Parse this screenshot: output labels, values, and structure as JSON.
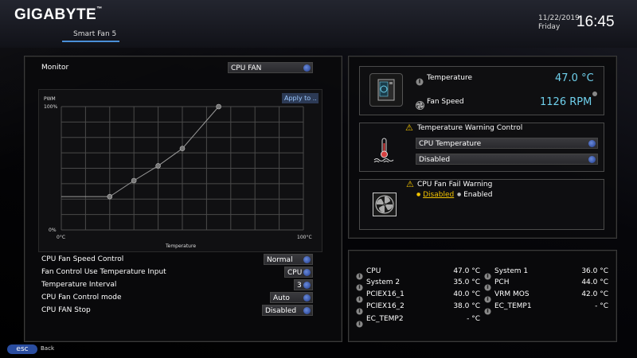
{
  "header": {
    "logo": "GIGABYTE",
    "logo_mark": "™",
    "section": "Smart Fan 5",
    "date": "11/22/2019",
    "day": "Friday",
    "time": "16:45"
  },
  "monitor": {
    "label": "Monitor",
    "selected": "CPU FAN"
  },
  "chart": {
    "apply_label": "Apply to ..",
    "ylabel": "PWM",
    "xlabel": "Temperature",
    "y_max_label": "100%",
    "y_min_label": "0%",
    "x_min_label": "0°C",
    "x_max_label": "100°C"
  },
  "chart_data": {
    "type": "line",
    "xlabel": "Temperature",
    "ylabel": "PWM",
    "x_tick_labels": [
      "0°C",
      "100°C"
    ],
    "y_tick_labels": [
      "0%",
      "100%"
    ],
    "xlim": [
      0,
      100
    ],
    "ylim": [
      0,
      100
    ],
    "grid": true,
    "series": [
      {
        "x": [
          0,
          20,
          30,
          40,
          50,
          65
        ],
        "y": [
          27,
          27,
          40,
          52,
          66,
          100
        ]
      }
    ]
  },
  "settings": [
    {
      "label": "CPU Fan Speed Control",
      "value": "Normal"
    },
    {
      "label": "Fan Control Use Temperature Input",
      "value": "CPU"
    },
    {
      "label": "Temperature Interval",
      "value": "3"
    },
    {
      "label": "CPU Fan Control mode",
      "value": "Auto"
    },
    {
      "label": "CPU FAN Stop",
      "value": "Disabled"
    }
  ],
  "status": {
    "temp_label": "Temperature",
    "temp_value": "47.0 °C",
    "fan_label": "Fan Speed",
    "fan_value": "1126 RPM"
  },
  "warning": {
    "title": "Temperature Warning Control",
    "source": "CPU Temperature",
    "state": "Disabled"
  },
  "fail_warning": {
    "title": "CPU Fan Fail Warning",
    "option_disabled": "Disabled",
    "option_enabled": "Enabled",
    "selected": "Disabled"
  },
  "sensors_left": [
    {
      "label": "CPU",
      "value": "47.0 °C"
    },
    {
      "label": "System 2",
      "value": "35.0 °C"
    },
    {
      "label": "PCIEX16_1",
      "value": "40.0 °C"
    },
    {
      "label": "PCIEX16_2",
      "value": "38.0 °C"
    },
    {
      "label": "EC_TEMP2",
      "value": "- °C"
    }
  ],
  "sensors_right": [
    {
      "label": "System 1",
      "value": "36.0 °C"
    },
    {
      "label": "PCH",
      "value": "44.0 °C"
    },
    {
      "label": "VRM MOS",
      "value": "42.0 °C"
    },
    {
      "label": "EC_TEMP1",
      "value": "- °C"
    }
  ],
  "footer": {
    "esc_label": "esc",
    "back_label": "Back"
  },
  "colors": {
    "accent_blue": "#6fd0ec",
    "warning_yellow": "#f2c300",
    "selector_blue": "#2a4da0"
  }
}
